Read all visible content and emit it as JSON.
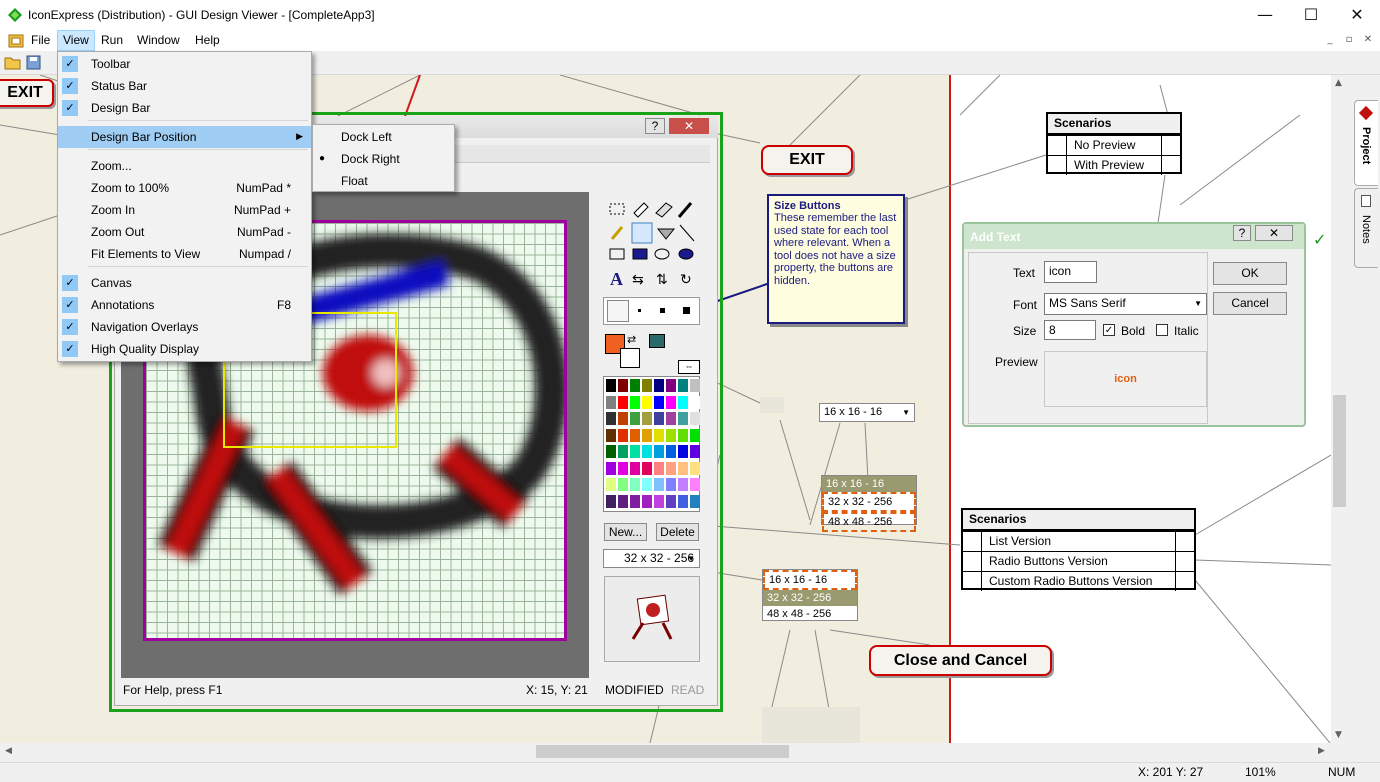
{
  "window": {
    "title": "IconExpress (Distribution) - GUI Design Viewer - [CompleteApp3]",
    "minimize": "—",
    "maximize": "☐",
    "close": "✕"
  },
  "menubar": {
    "items": [
      "File",
      "View",
      "Run",
      "Window",
      "Help"
    ],
    "mdi_controls": [
      "_",
      "▫",
      "✕"
    ]
  },
  "view_menu": {
    "items": [
      {
        "label": "Toolbar",
        "checked": true,
        "shortcut": ""
      },
      {
        "label": "Status Bar",
        "checked": true,
        "shortcut": ""
      },
      {
        "label": "Design Bar",
        "checked": true,
        "shortcut": ""
      },
      {
        "label": "Design Bar Position",
        "checked": false,
        "shortcut": "",
        "submenu": true
      },
      {
        "label": "Zoom...",
        "checked": false,
        "shortcut": ""
      },
      {
        "label": "Zoom to 100%",
        "checked": false,
        "shortcut": "NumPad *"
      },
      {
        "label": "Zoom In",
        "checked": false,
        "shortcut": "NumPad +"
      },
      {
        "label": "Zoom Out",
        "checked": false,
        "shortcut": "NumPad -"
      },
      {
        "label": "Fit Elements to View",
        "checked": false,
        "shortcut": "Numpad /"
      },
      {
        "label": "Canvas",
        "checked": true,
        "shortcut": ""
      },
      {
        "label": "Annotations",
        "checked": true,
        "shortcut": "F8"
      },
      {
        "label": "Navigation Overlays",
        "checked": true,
        "shortcut": ""
      },
      {
        "label": "High Quality Display",
        "checked": true,
        "shortcut": ""
      }
    ]
  },
  "submenu": {
    "items": [
      "Dock Left",
      "Dock Right",
      "Float"
    ],
    "selected": "Dock Right"
  },
  "canvas": {
    "exit_left": "EXIT",
    "exit_button": "EXIT",
    "close_cancel": "Close and Cancel",
    "size_buttons_title": "Size Buttons",
    "size_buttons_text": "These remember the last used state for each tool where relevant. When a tool does not have a size property, the buttons are hidden.",
    "scenarios_top": {
      "title": "Scenarios",
      "rows": [
        "No Preview",
        "With Preview"
      ]
    },
    "scenarios_bottom": {
      "title": "Scenarios",
      "rows": [
        "List Version",
        "Radio Buttons Version",
        "Custom Radio Buttons Version"
      ]
    },
    "size_combo": "16 x 16 - 16",
    "size_list_a": [
      "16 x 16 - 16",
      "32 x 32 - 256",
      "48 x 48 - 256"
    ],
    "size_list_b": [
      "16 x 16 - 16",
      "32 x 32 - 256",
      "48 x 48 - 256"
    ]
  },
  "editor": {
    "new_button": "New...",
    "delete_button": "Delete",
    "size_select": "32 x 32 - 256",
    "status_help": "For Help, press F1",
    "status_coords": "X: 15, Y: 21",
    "status_modified": "MODIFIED",
    "status_read": "READ"
  },
  "add_text_dialog": {
    "title": "Add Text",
    "text_label": "Text",
    "text_value": "icon",
    "font_label": "Font",
    "font_value": "MS Sans Serif",
    "size_label": "Size",
    "size_value": "8",
    "bold_label": "Bold",
    "italic_label": "Italic",
    "preview_label": "Preview",
    "preview_text": "icon",
    "ok": "OK",
    "cancel": "Cancel"
  },
  "side_tabs": [
    "Project",
    "Notes"
  ],
  "statusbar": {
    "coords": "X: 201  Y: 27",
    "zoom": "101%",
    "num": "NUM"
  },
  "colors": {
    "accent_red": "#c00000",
    "frame_green": "#1aa31a",
    "callout_blue": "#1a1a80",
    "orange": "#f06020"
  }
}
